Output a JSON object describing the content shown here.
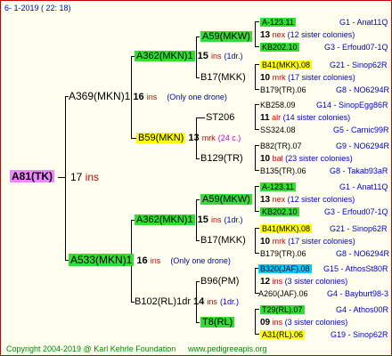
{
  "header": {
    "date": "6-  1-2019 ( 22: 18)"
  },
  "root": {
    "name": "A81(TK)",
    "count": "17",
    "unit": "ins"
  },
  "gen1": [
    {
      "name": "A369(MKN)1",
      "count": "16",
      "unit": "ins",
      "note": "(Only one drone)"
    },
    {
      "name": "A533(MKN)1",
      "count": "16",
      "unit": "ins",
      "note": "(Only one drone)"
    }
  ],
  "gen2": [
    {
      "name": "A362(MKN)1",
      "count": "15",
      "unit": "ins",
      "note": "(1dr.)"
    },
    {
      "name": "B59(MKN)",
      "count": "13",
      "unit": "mrk",
      "note": "(24 c.)"
    },
    {
      "name": "A362(MKN)1",
      "count": "15",
      "unit": "ins",
      "note": "(1dr.)"
    },
    {
      "name": "B102(RL)1dr",
      "count": "14",
      "unit": "ins",
      "note": "(1dr.)"
    }
  ],
  "gen3": [
    {
      "name": "A59(MKW)"
    },
    {
      "name": "B17(MKK)"
    },
    {
      "name": "ST206"
    },
    {
      "name": "B129(TR)"
    },
    {
      "name": "A59(MKW)"
    },
    {
      "name": "B17(MKK)"
    },
    {
      "name": "B96(PM)"
    },
    {
      "name": "T8(RL)"
    }
  ],
  "gen4": [
    {
      "name": "A-123.11",
      "info": "G1 - Anat11Q"
    },
    {
      "count": "13",
      "unit": "nex",
      "note": "(12 sister colonies)"
    },
    {
      "name": "KB202.10",
      "info": "G3 - Erfoud07-1Q"
    },
    {
      "name": "B41(MKK).08",
      "info": "G21 - Sinop62R"
    },
    {
      "count": "10",
      "unit": "mrk",
      "note": "(17 sister colonies)"
    },
    {
      "name": "B179(TR).06",
      "info": "G8 - NO6294R"
    },
    {
      "name": "KB258.09",
      "info": "G14 - SinopEgg86R"
    },
    {
      "count": "11",
      "unit": "alr",
      "note": "(14 sister colonies)"
    },
    {
      "name": "SS324.08",
      "info": "G5 - Carnic99R"
    },
    {
      "name": "B82(TR).07",
      "info": "G9 - NO6294R"
    },
    {
      "count": "10",
      "unit": "bal",
      "note": "(23 sister colonies)"
    },
    {
      "name": "B135(TR).06",
      "info": "G8 - Takab93aR"
    },
    {
      "name": "A-123.11",
      "info": "G1 - Anat11Q"
    },
    {
      "count": "13",
      "unit": "nex",
      "note": "(12 sister colonies)"
    },
    {
      "name": "KB202.10",
      "info": "G3 - Erfoud07-1Q"
    },
    {
      "name": "B41(MKK).08",
      "info": "G21 - Sinop62R"
    },
    {
      "count": "10",
      "unit": "mrk",
      "note": "(17 sister colonies)"
    },
    {
      "name": "B179(TR).06",
      "info": "G8 - NO6294R"
    },
    {
      "name": "B320(JAF).08",
      "info": "G15 - AthosSt80R"
    },
    {
      "count": "12",
      "unit": "ins",
      "note": "(3 sister colonies)"
    },
    {
      "name": "A260(JAF).06",
      "info": "G4 - Bayburt98-3"
    },
    {
      "name": "T29(RL).07",
      "info": "G4 - Athos00R"
    },
    {
      "count": "09",
      "unit": "ins",
      "note": "(3 sister colonies)"
    },
    {
      "name": "A31(RL).06",
      "info": "G19 - Sinop62R"
    }
  ],
  "footer": {
    "copyright": "Copyright 2004-2019 @ Karl Kehrle Foundation",
    "url": "www.pedigreeapis.org"
  },
  "colors": {
    "green": "#33dd33",
    "yellow": "#ffff00",
    "blue": "#00ccff",
    "magenta": "#ee88ff",
    "border": "#cc0000"
  }
}
